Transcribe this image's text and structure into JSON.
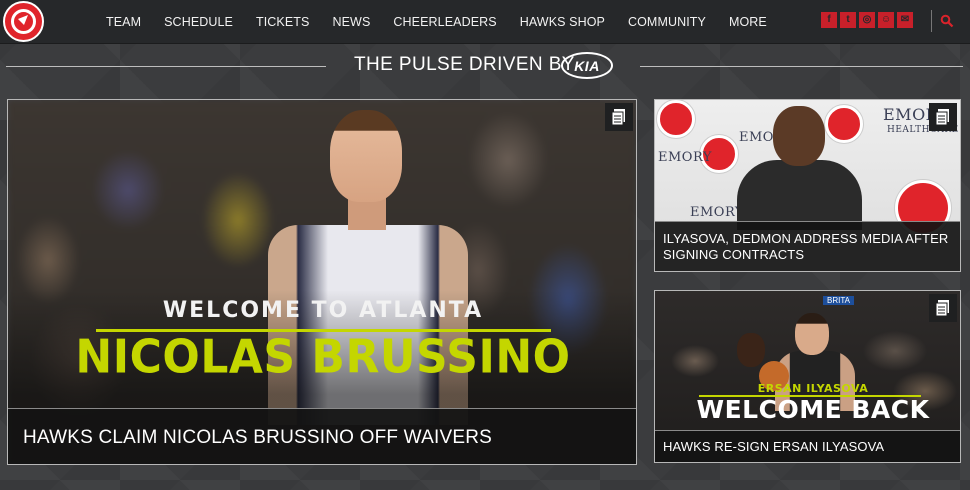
{
  "nav": {
    "items": [
      "TEAM",
      "SCHEDULE",
      "TICKETS",
      "NEWS",
      "CHEERLEADERS",
      "HAWKS SHOP",
      "COMMUNITY",
      "MORE"
    ],
    "social": [
      {
        "icon": "facebook-icon",
        "glyph": "f"
      },
      {
        "icon": "twitter-icon",
        "glyph": "t"
      },
      {
        "icon": "instagram-icon",
        "glyph": "◎"
      },
      {
        "icon": "snapchat-icon",
        "glyph": "☺"
      },
      {
        "icon": "email-icon",
        "glyph": "✉"
      }
    ],
    "accent_color": "#c8202a"
  },
  "section": {
    "title": "THE PULSE DRIVEN BY",
    "sponsor": "KIA"
  },
  "cards": {
    "main": {
      "overlay_small": "WELCOME TO ATLANTA",
      "overlay_big": "NICOLAS BRUSSINO",
      "caption": "HAWKS CLAIM NICOLAS BRUSSINO OFF WAIVERS",
      "icon": "article-icon"
    },
    "top_right": {
      "caption": "ILYASOVA, DEDMON ADDRESS MEDIA AFTER SIGNING CONTRACTS",
      "backdrop_text": [
        "EMORY",
        "HEALTHCARE"
      ],
      "icon": "article-icon"
    },
    "bottom_right": {
      "overlay_small": "ERSAN ILYASOVA",
      "overlay_big": "WELCOME BACK",
      "banner": "BRITA",
      "caption": "HAWKS RE-SIGN ERSAN ILYASOVA",
      "icon": "article-icon"
    }
  },
  "colors": {
    "volt_green": "#c4d600",
    "hawks_red": "#e0242b",
    "nav_bg": "#26282a"
  }
}
